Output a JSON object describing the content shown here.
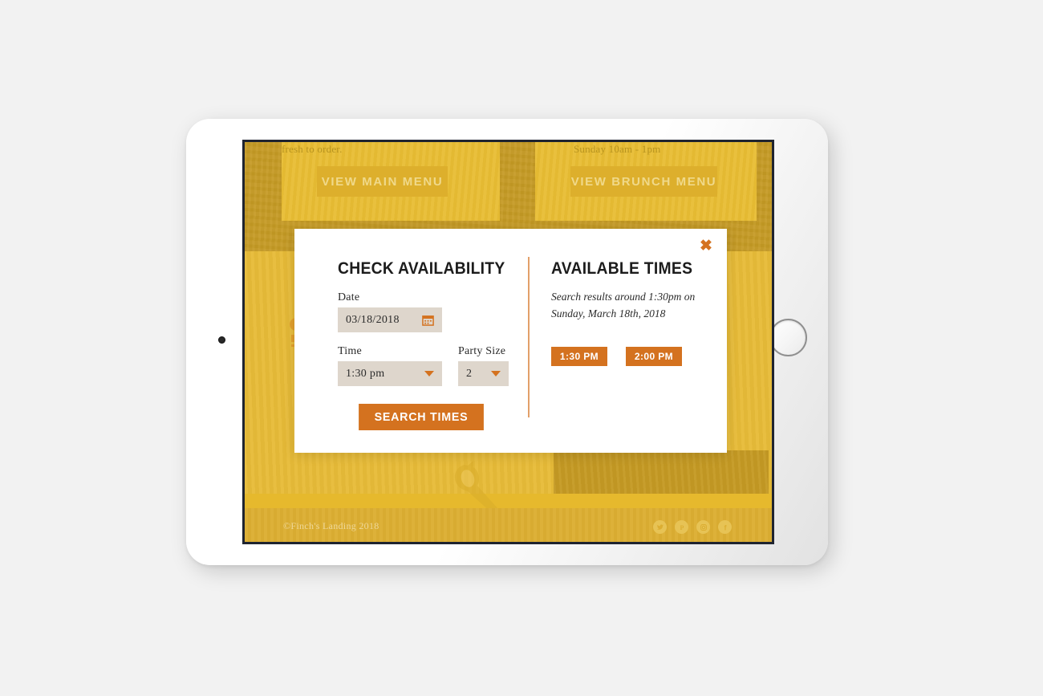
{
  "site": {
    "menu_cards": [
      {
        "caption": "fresh to order.",
        "button_label": "VIEW MAIN MENU"
      },
      {
        "caption": "Sunday 10am - 1pm",
        "button_label": "VIEW BRUNCH MENU"
      }
    ],
    "footer": {
      "copyright": "©Finch's Landing 2018",
      "social": [
        {
          "name": "twitter-icon",
          "glyph": "🐦"
        },
        {
          "name": "pinterest-icon",
          "glyph": "P"
        },
        {
          "name": "instagram-icon",
          "glyph": "▣"
        },
        {
          "name": "facebook-icon",
          "glyph": "f"
        }
      ]
    }
  },
  "modal": {
    "close_label": "✖",
    "left": {
      "heading": "CHECK AVAILABILITY",
      "date_label": "Date",
      "date_value": "03/18/2018",
      "date_icon": "calendar-icon",
      "time_label": "Time",
      "time_value": "1:30 pm",
      "party_label": "Party Size",
      "party_value": "2",
      "submit_label": "SEARCH TIMES"
    },
    "right": {
      "heading": "AVAILABLE TIMES",
      "results_text": "Search results around 1:30pm on Sunday, March 18th, 2018",
      "slots": [
        {
          "label": "1:30 PM"
        },
        {
          "label": "2:00 PM"
        }
      ]
    }
  },
  "colors": {
    "accent_orange": "#d4721f",
    "gold_light": "#e7bb38",
    "gold_dark": "#c59a24",
    "input_bg": "#ded6cc",
    "modal_bg": "#ffffff"
  }
}
